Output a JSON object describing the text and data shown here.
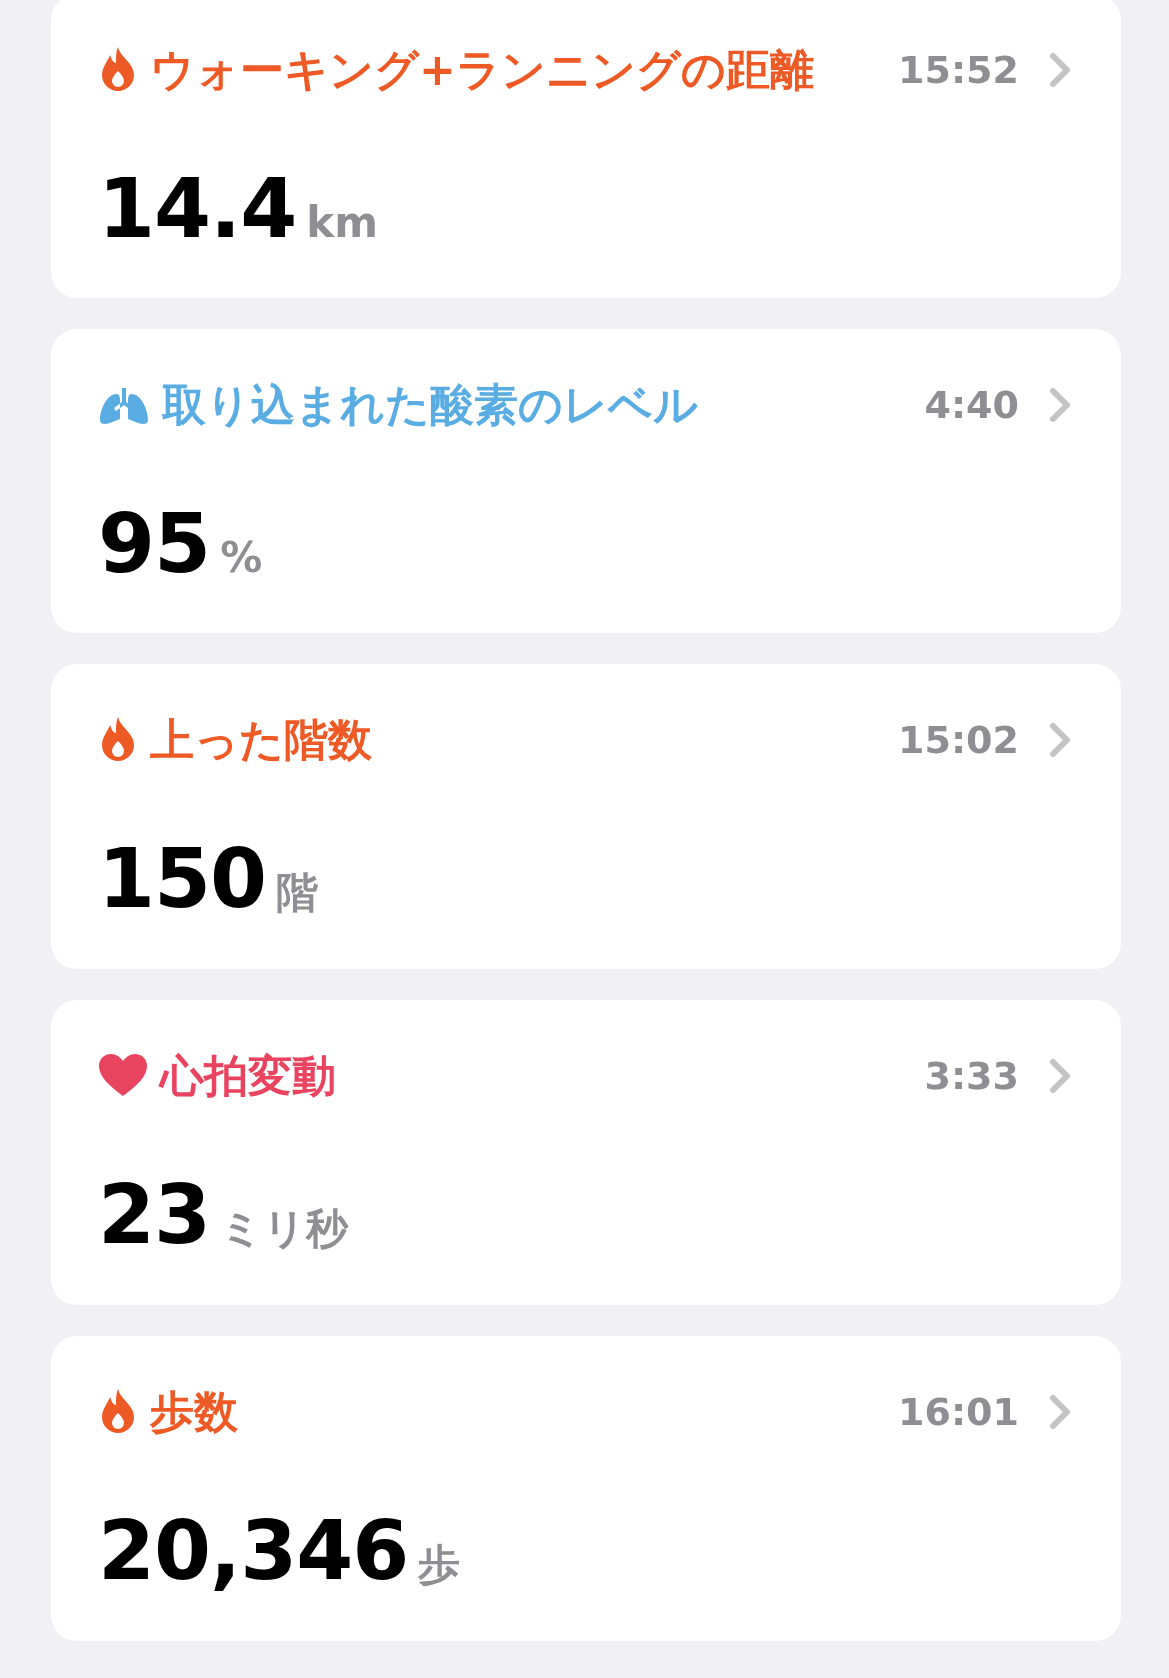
{
  "cards": [
    {
      "kind": "flame",
      "color": "#ee5a26",
      "title": "ウォーキング+ランニングの距離",
      "time": "15:52",
      "value": "14.4",
      "unit": "km"
    },
    {
      "kind": "lungs",
      "color": "#5aade2",
      "title": "取り込まれた酸素のレベル",
      "time": "4:40",
      "value": "95",
      "unit": "%"
    },
    {
      "kind": "flame",
      "color": "#ee5a26",
      "title": "上った階数",
      "time": "15:02",
      "value": "150",
      "unit": "階"
    },
    {
      "kind": "heart",
      "color": "#e9445f",
      "title": "心拍変動",
      "time": "3:33",
      "value": "23",
      "unit": "ミリ秒"
    },
    {
      "kind": "flame",
      "color": "#ee5a26",
      "title": "歩数",
      "time": "16:01",
      "value": "20,346",
      "unit": "歩"
    }
  ]
}
